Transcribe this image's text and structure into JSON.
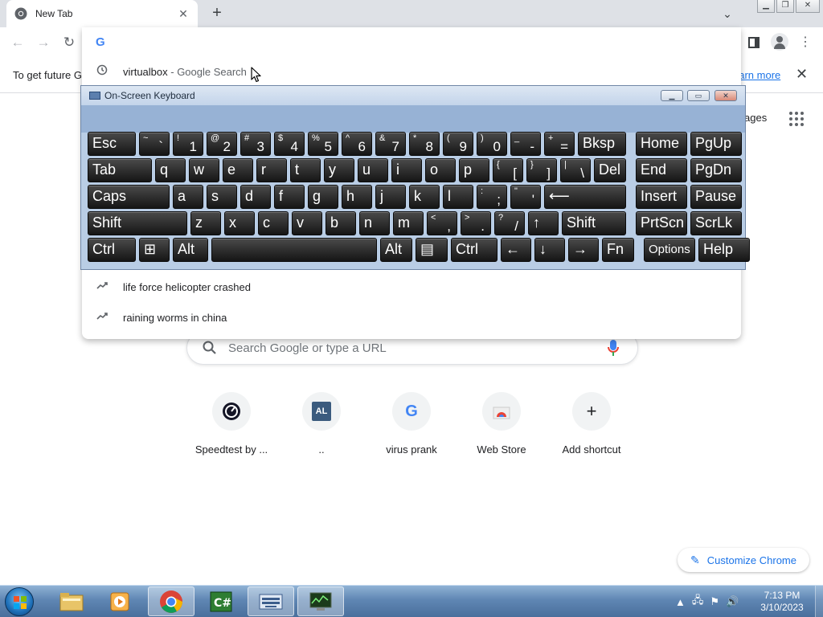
{
  "browser": {
    "tab": {
      "title": "New Tab"
    },
    "infobar": {
      "text": "To get future G",
      "link": "earn more"
    },
    "omnibox": {
      "value": "",
      "suggestions": [
        {
          "icon": "history-icon",
          "text": "virtualbox",
          "sub": " - Google Search"
        },
        {
          "icon": "trending-icon",
          "text": "life force helicopter crashed",
          "sub": ""
        },
        {
          "icon": "trending-icon",
          "text": "raining worms in china",
          "sub": ""
        }
      ]
    }
  },
  "ntp": {
    "header_link": "ages",
    "search_placeholder": "Search Google or type a URL",
    "shortcuts": [
      {
        "label": "Speedtest by ...",
        "icon": "speedtest-icon"
      },
      {
        "label": "..",
        "icon": "al-icon",
        "tile_text": "AL"
      },
      {
        "label": "virus prank",
        "icon": "google-icon",
        "tile_text": "G"
      },
      {
        "label": "Web Store",
        "icon": "webstore-icon"
      },
      {
        "label": "Add shortcut",
        "icon": "plus-icon",
        "tile_text": "+"
      }
    ],
    "customize_label": "Customize Chrome"
  },
  "osk": {
    "title": "On-Screen Keyboard",
    "rows": [
      [
        {
          "l": "Esc"
        },
        {
          "s": "~",
          "m": "`"
        },
        {
          "s": "!",
          "m": "1"
        },
        {
          "s": "@",
          "m": "2"
        },
        {
          "s": "#",
          "m": "3"
        },
        {
          "s": "$",
          "m": "4"
        },
        {
          "s": "%",
          "m": "5"
        },
        {
          "s": "^",
          "m": "6"
        },
        {
          "s": "&",
          "m": "7"
        },
        {
          "s": "*",
          "m": "8"
        },
        {
          "s": "(",
          "m": "9"
        },
        {
          "s": ")",
          "m": "0"
        },
        {
          "s": "_",
          "m": "-"
        },
        {
          "s": "+",
          "m": "="
        },
        {
          "l": "Bksp"
        },
        {
          "l": "Home"
        },
        {
          "l": "PgUp"
        }
      ],
      [
        {
          "l": "Tab"
        },
        {
          "l": "q"
        },
        {
          "l": "w"
        },
        {
          "l": "e"
        },
        {
          "l": "r"
        },
        {
          "l": "t"
        },
        {
          "l": "y"
        },
        {
          "l": "u"
        },
        {
          "l": "i"
        },
        {
          "l": "o"
        },
        {
          "l": "p"
        },
        {
          "s": "{",
          "m": "["
        },
        {
          "s": "}",
          "m": "]"
        },
        {
          "s": "|",
          "m": "\\"
        },
        {
          "l": "Del"
        },
        {
          "l": "End"
        },
        {
          "l": "PgDn"
        }
      ],
      [
        {
          "l": "Caps"
        },
        {
          "l": "a"
        },
        {
          "l": "s"
        },
        {
          "l": "d"
        },
        {
          "l": "f"
        },
        {
          "l": "g"
        },
        {
          "l": "h"
        },
        {
          "l": "j"
        },
        {
          "l": "k"
        },
        {
          "l": "l"
        },
        {
          "s": ":",
          "m": ";"
        },
        {
          "s": "\"",
          "m": "'"
        },
        {
          "l": "⟵"
        },
        {
          "l": "Insert"
        },
        {
          "l": "Pause"
        }
      ],
      [
        {
          "l": "Shift"
        },
        {
          "l": "z"
        },
        {
          "l": "x"
        },
        {
          "l": "c"
        },
        {
          "l": "v"
        },
        {
          "l": "b"
        },
        {
          "l": "n"
        },
        {
          "l": "m"
        },
        {
          "s": "<",
          "m": ","
        },
        {
          "s": ">",
          "m": "."
        },
        {
          "s": "?",
          "m": "/"
        },
        {
          "l": "↑"
        },
        {
          "l": "Shift"
        },
        {
          "l": "PrtScn"
        },
        {
          "l": "ScrLk"
        }
      ],
      [
        {
          "l": "Ctrl"
        },
        {
          "l": "⊞"
        },
        {
          "l": "Alt"
        },
        {
          "l": ""
        },
        {
          "l": "Alt"
        },
        {
          "l": "▤"
        },
        {
          "l": "Ctrl"
        },
        {
          "l": "←"
        },
        {
          "l": "↓"
        },
        {
          "l": "→"
        },
        {
          "l": "Fn"
        },
        {
          "l": "Options"
        },
        {
          "l": "Help"
        }
      ]
    ]
  },
  "taskbar": {
    "apps": [
      "explorer-icon",
      "media-player-icon",
      "chrome-icon",
      "csharp-icon",
      "osk-icon",
      "network-monitor-icon"
    ],
    "time": "7:13 PM",
    "date": "3/10/2023"
  }
}
